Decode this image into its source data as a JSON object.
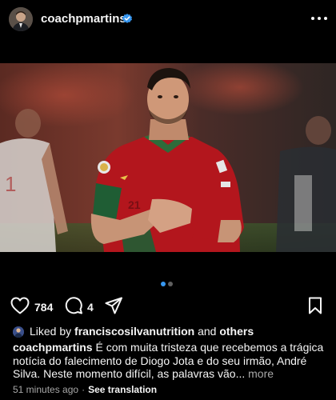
{
  "post": {
    "username": "coachpmartins",
    "avatar_icon": "profile-avatar",
    "verified_icon": "verified-badge-icon",
    "verified_color": "#3797f0"
  },
  "carousel": {
    "total": 2,
    "active_index": 0,
    "active_color": "#3797f0"
  },
  "actions": {
    "likes": "784",
    "comments": "4"
  },
  "liked_by": {
    "prefix": "Liked by ",
    "user": "franciscosilvanutrition",
    "middle": " and ",
    "others": "others"
  },
  "caption": {
    "user": "coachpmartins",
    "text": "É com muita tristeza que recebemos a trágica notícia do falecimento de Diogo Jota e do seu irmão, André Silva. Neste momento difícil, as palavras vão...",
    "more": "more"
  },
  "meta": {
    "time": "51 minutes ago",
    "separator": "·",
    "translate": "See translation"
  }
}
